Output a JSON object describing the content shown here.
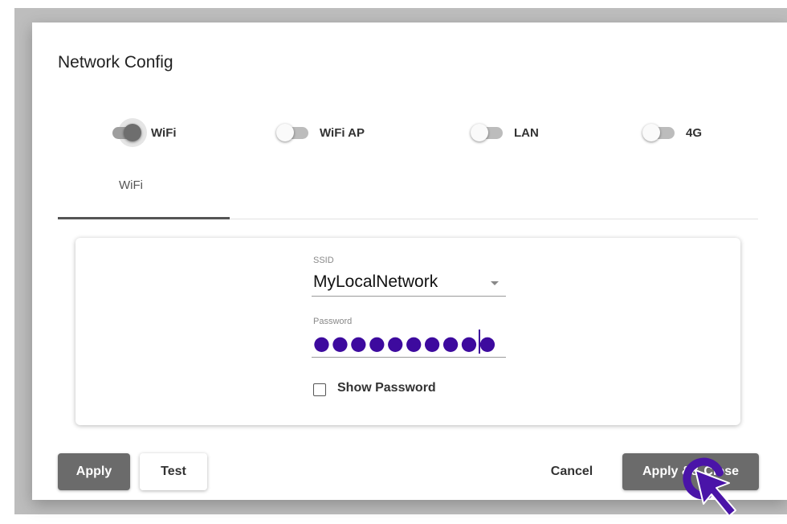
{
  "dialog": {
    "title": "Network Config",
    "toggles": [
      {
        "label": "WiFi",
        "on": true
      },
      {
        "label": "WiFi AP",
        "on": false
      },
      {
        "label": "LAN",
        "on": false
      },
      {
        "label": "4G",
        "on": false
      }
    ],
    "tabs": [
      {
        "label": "WiFi",
        "active": true
      }
    ],
    "form": {
      "ssid_label": "SSID",
      "ssid_value": "MyLocalNetwork",
      "password_label": "Password",
      "password_masked": "●●●●●●●●●●",
      "show_password_label": "Show Password",
      "show_password_checked": false
    },
    "buttons": {
      "apply": "Apply",
      "test": "Test",
      "cancel": "Cancel",
      "apply_close": "Apply && Close"
    }
  },
  "colors": {
    "primary_button": "#6b6b6b",
    "password_text": "#3d0a9e",
    "cursor": "#4a14a8"
  },
  "icons": [
    "dropdown-arrow-icon",
    "checkbox-icon",
    "pointer-cursor-icon"
  ]
}
